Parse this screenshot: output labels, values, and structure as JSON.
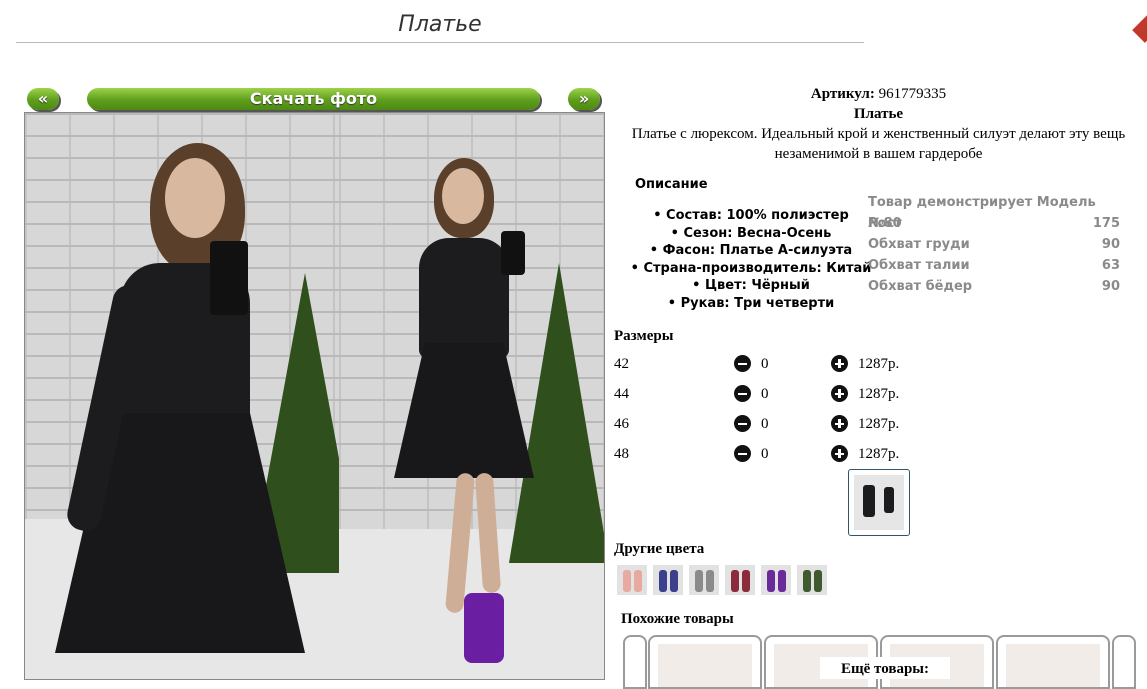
{
  "page": {
    "title": "Платье"
  },
  "gallery": {
    "prev_label": "«",
    "download_label": "Скачать фото",
    "next_label": "»"
  },
  "product": {
    "sku_label": "Артикул:",
    "sku_value": "961779335",
    "name": "Платье",
    "description": "Платье с люрексом. Идеальный крой и женственный силуэт делают эту вещь незаменимой в вашем гардеробе"
  },
  "description_section": {
    "heading": "Описание",
    "items": [
      "Состав: 100% полиэстер",
      "Сезон: Весна-Осень",
      "Фасон: Платье А-силуэта",
      "Страна-производитель: Китай",
      "Цвет: Чёрный",
      "Рукав: Три четверти"
    ]
  },
  "model": {
    "heading": "Товар демонстрирует Модель №80",
    "rows": [
      {
        "label": "Рост",
        "value": "175"
      },
      {
        "label": "Обхват груди",
        "value": "90"
      },
      {
        "label": "Обхват талии",
        "value": "63"
      },
      {
        "label": "Обхват бёдер",
        "value": "90"
      }
    ]
  },
  "sizes": {
    "heading": "Размеры",
    "rows": [
      {
        "size": "42",
        "qty": "0",
        "price": "1287р."
      },
      {
        "size": "44",
        "qty": "0",
        "price": "1287р."
      },
      {
        "size": "46",
        "qty": "0",
        "price": "1287р."
      },
      {
        "size": "48",
        "qty": "0",
        "price": "1287р."
      }
    ]
  },
  "other_colors": {
    "heading": "Другие цвета",
    "swatches": [
      "#e8a9a0",
      "#3b3f8c",
      "#8a8a8a",
      "#8b2a3a",
      "#6a2a9a",
      "#3f5a2f"
    ]
  },
  "similar": {
    "heading": "Похожие товары"
  },
  "more": {
    "label": "Ещё товары:"
  },
  "colors": {
    "accent_green": "#5e9e1c",
    "dress": "#1c1c1f"
  }
}
